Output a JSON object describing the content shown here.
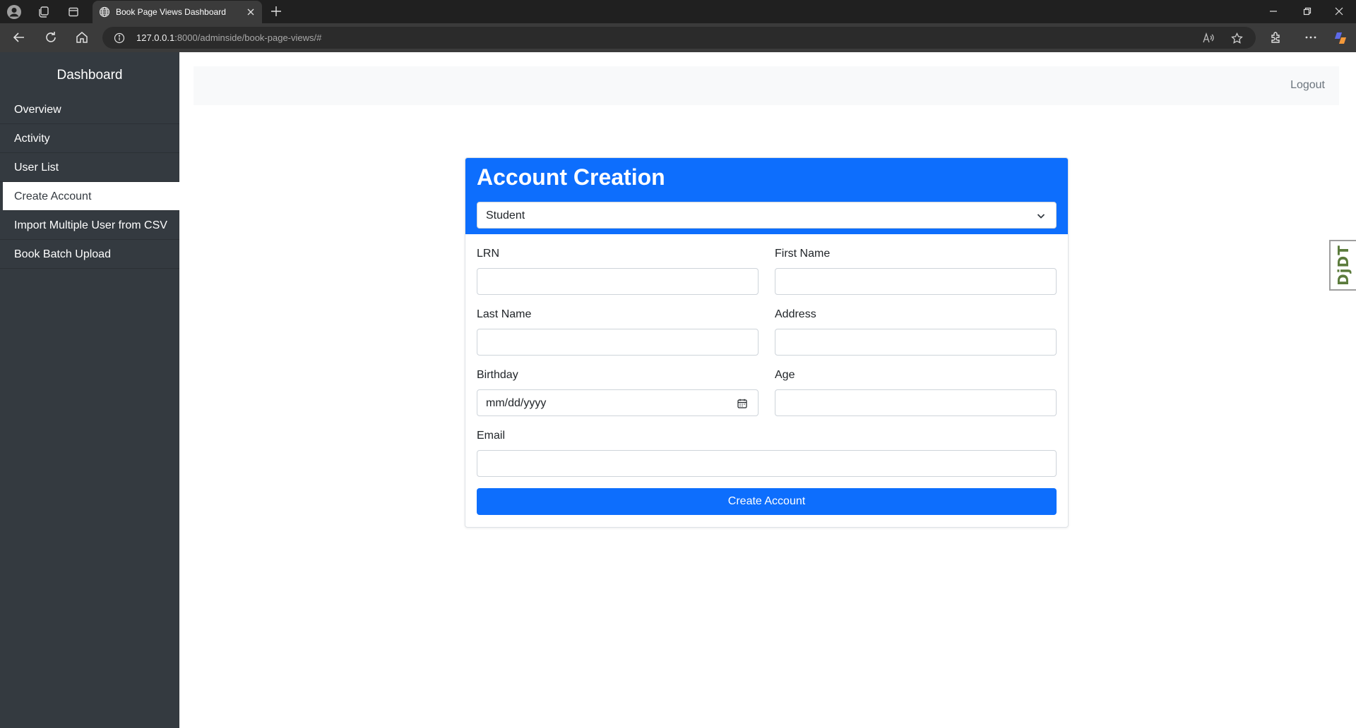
{
  "browser": {
    "tab_title": "Book Page Views Dashboard",
    "url_host": "127.0.0.1",
    "url_rest": ":8000/adminside/book-page-views/#"
  },
  "sidebar": {
    "title": "Dashboard",
    "items": [
      {
        "label": "Overview",
        "active": false
      },
      {
        "label": "Activity",
        "active": false
      },
      {
        "label": "User List",
        "active": false
      },
      {
        "label": "Create Account",
        "active": true
      },
      {
        "label": "Import Multiple User from CSV",
        "active": false
      },
      {
        "label": "Book Batch Upload",
        "active": false
      }
    ]
  },
  "topbar": {
    "logout_label": "Logout"
  },
  "form": {
    "title": "Account Creation",
    "role_selected": "Student",
    "fields": {
      "lrn": {
        "label": "LRN",
        "value": ""
      },
      "first_name": {
        "label": "First Name",
        "value": ""
      },
      "last_name": {
        "label": "Last Name",
        "value": ""
      },
      "address": {
        "label": "Address",
        "value": ""
      },
      "birthday": {
        "label": "Birthday",
        "placeholder": "mm/dd/yyyy"
      },
      "age": {
        "label": "Age",
        "value": ""
      },
      "email": {
        "label": "Email",
        "value": ""
      }
    },
    "submit_label": "Create Account"
  },
  "debug_toolbar": {
    "label": "DjDT"
  },
  "colors": {
    "primary": "#0d6efd",
    "sidebar_bg": "#343a40",
    "topbar_bg": "#f8f9fa"
  }
}
